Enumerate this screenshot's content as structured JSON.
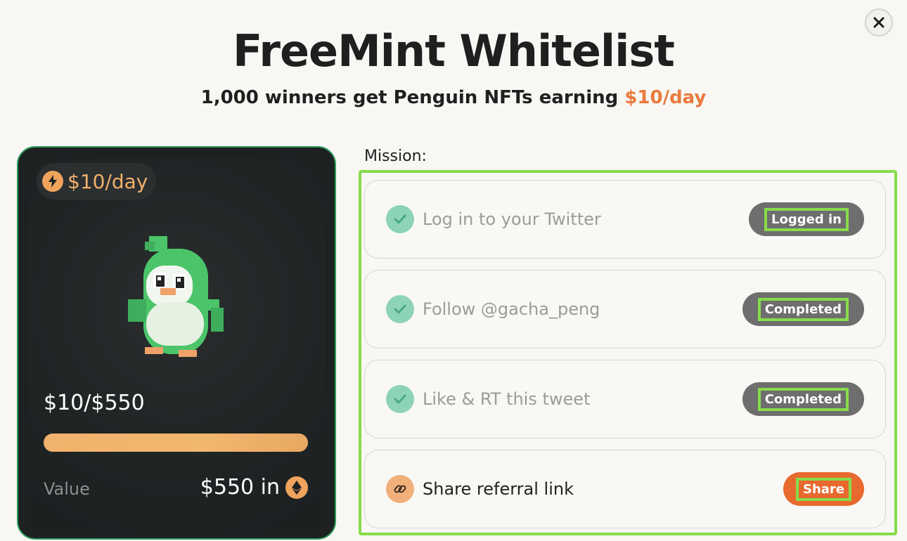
{
  "modal": {
    "title": "FreeMint Whitelist",
    "subtitle_prefix": "1,000 winners get Penguin NFTs earning ",
    "subtitle_accent": "$10/day",
    "close_icon": "close-icon"
  },
  "nft_card": {
    "rate": "$10/day",
    "rate_icon": "lightning-bolt-icon",
    "progress_label": "$10/$550",
    "progress_fraction": 1.0,
    "value_label": "Value",
    "value_amount": "$550 in",
    "currency_icon": "ethereum-icon"
  },
  "mission": {
    "label": "Mission:",
    "items": [
      {
        "text": "Log in to your Twitter",
        "status": "Logged in",
        "icon": "check-icon",
        "done": true
      },
      {
        "text": "Follow @gacha_peng",
        "status": "Completed",
        "icon": "check-icon",
        "done": true
      },
      {
        "text": "Like & RT this tweet",
        "status": "Completed",
        "icon": "check-icon",
        "done": true
      },
      {
        "text": "Share referral link",
        "status": "Share",
        "icon": "link-icon",
        "done": false
      }
    ]
  },
  "colors": {
    "accent_orange": "#ea7a3c",
    "highlight_green": "#86dc4a",
    "card_border_green": "#2f9a5a",
    "check_green": "#8dd3b7"
  }
}
